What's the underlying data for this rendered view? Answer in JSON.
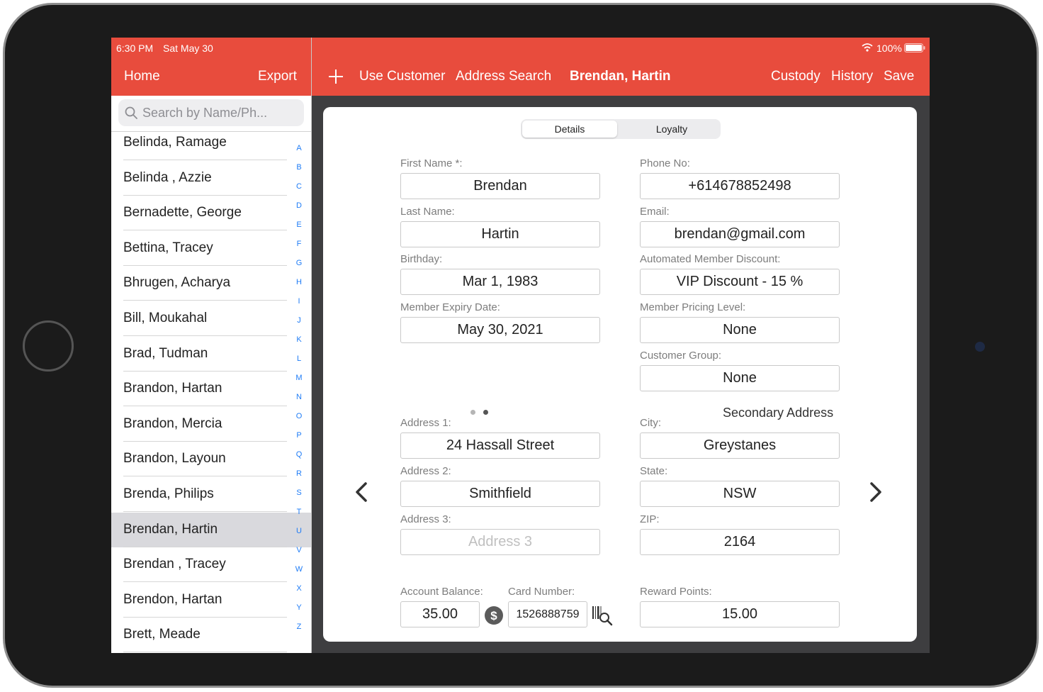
{
  "status": {
    "time": "6:30 PM",
    "date": "Sat May 30",
    "battery": "100%"
  },
  "left_nav": {
    "home": "Home",
    "export": "Export"
  },
  "search": {
    "placeholder": "Search by Name/Ph..."
  },
  "customers": [
    "Belinda, Ramage",
    "Belinda , Azzie",
    "Bernadette, George",
    "Bettina, Tracey",
    "Bhrugen, Acharya",
    "Bill, Moukahal",
    "Brad, Tudman",
    "Brandon, Hartan",
    "Brandon, Mercia",
    "Brandon, Layoun",
    "Brenda, Philips",
    "Brendan, Hartin",
    "Brendan , Tracey",
    "Brendon, Hartan",
    "Brett, Meade"
  ],
  "selected_customer": "Brendan, Hartin",
  "index_letters": [
    "A",
    "B",
    "C",
    "D",
    "E",
    "F",
    "G",
    "H",
    "I",
    "J",
    "K",
    "L",
    "M",
    "N",
    "O",
    "P",
    "Q",
    "R",
    "S",
    "T",
    "U",
    "V",
    "W",
    "X",
    "Y",
    "Z"
  ],
  "right_nav": {
    "add": "+",
    "use_customer": "Use Customer",
    "address_search": "Address Search",
    "title": "Brendan, Hartin",
    "custody": "Custody",
    "history": "History",
    "save": "Save"
  },
  "tabs": {
    "details": "Details",
    "loyalty": "Loyalty",
    "active": "details"
  },
  "form": {
    "first_name": {
      "label": "First Name *:",
      "value": "Brendan"
    },
    "last_name": {
      "label": "Last Name:",
      "value": "Hartin"
    },
    "birthday": {
      "label": "Birthday:",
      "value": "Mar 1, 1983"
    },
    "member_expiry": {
      "label": "Member Expiry Date:",
      "value": "May 30, 2021"
    },
    "phone": {
      "label": "Phone No:",
      "value": "+614678852498"
    },
    "email": {
      "label": "Email:",
      "value": "brendan@gmail.com"
    },
    "member_discount": {
      "label": "Automated Member Discount:",
      "value": "VIP Discount - 15 %"
    },
    "pricing_level": {
      "label": "Member Pricing Level:",
      "value": "None"
    },
    "customer_group": {
      "label": "Customer Group:",
      "value": "None"
    }
  },
  "address": {
    "secondary_title": "Secondary Address",
    "address1": {
      "label": "Address 1:",
      "value": "24 Hassall Street"
    },
    "address2": {
      "label": "Address 2:",
      "value": "Smithfield"
    },
    "address3": {
      "label": "Address 3:",
      "value": "",
      "placeholder": "Address 3"
    },
    "city": {
      "label": "City:",
      "value": "Greystanes"
    },
    "state": {
      "label": "State:",
      "value": "NSW"
    },
    "zip": {
      "label": "ZIP:",
      "value": "2164"
    },
    "page_count": 2,
    "current_page": 1
  },
  "account": {
    "balance": {
      "label": "Account Balance:",
      "value": "35.00"
    },
    "card": {
      "label": "Card Number:",
      "value": "1526888759"
    },
    "reward": {
      "label": "Reward Points:",
      "value": "15.00"
    }
  },
  "colors": {
    "accent": "#e84c3d",
    "index_blue": "#1f7cf6",
    "selected_row": "#d9d9dd"
  }
}
